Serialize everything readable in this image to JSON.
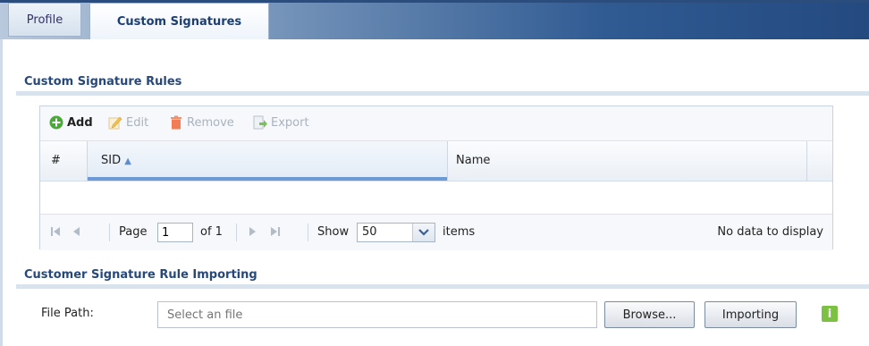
{
  "tabs": [
    {
      "label": "Profile",
      "active": false
    },
    {
      "label": "Custom Signatures",
      "active": true
    }
  ],
  "rules_section": {
    "title": "Custom Signature Rules",
    "toolbar": {
      "add": "Add",
      "edit": "Edit",
      "remove": "Remove",
      "export": "Export"
    },
    "columns": {
      "index": "#",
      "sid": "SID",
      "name": "Name"
    },
    "sort": {
      "column": "SID",
      "direction": "ascending"
    },
    "pager": {
      "page_label": "Page",
      "page_value": "1",
      "of_label": "of 1",
      "show_label": "Show",
      "show_value": "50",
      "items_label": "items",
      "status": "No data to display"
    }
  },
  "import_section": {
    "title": "Customer Signature Rule Importing",
    "file_path_label": "File Path:",
    "file_placeholder": "Select an file",
    "browse_label": "Browse...",
    "import_label": "Importing",
    "info_icon_text": "i"
  },
  "colors": {
    "accent": "#27497a",
    "sort_bar": "#6b9ad6",
    "info": "#7cc142"
  }
}
